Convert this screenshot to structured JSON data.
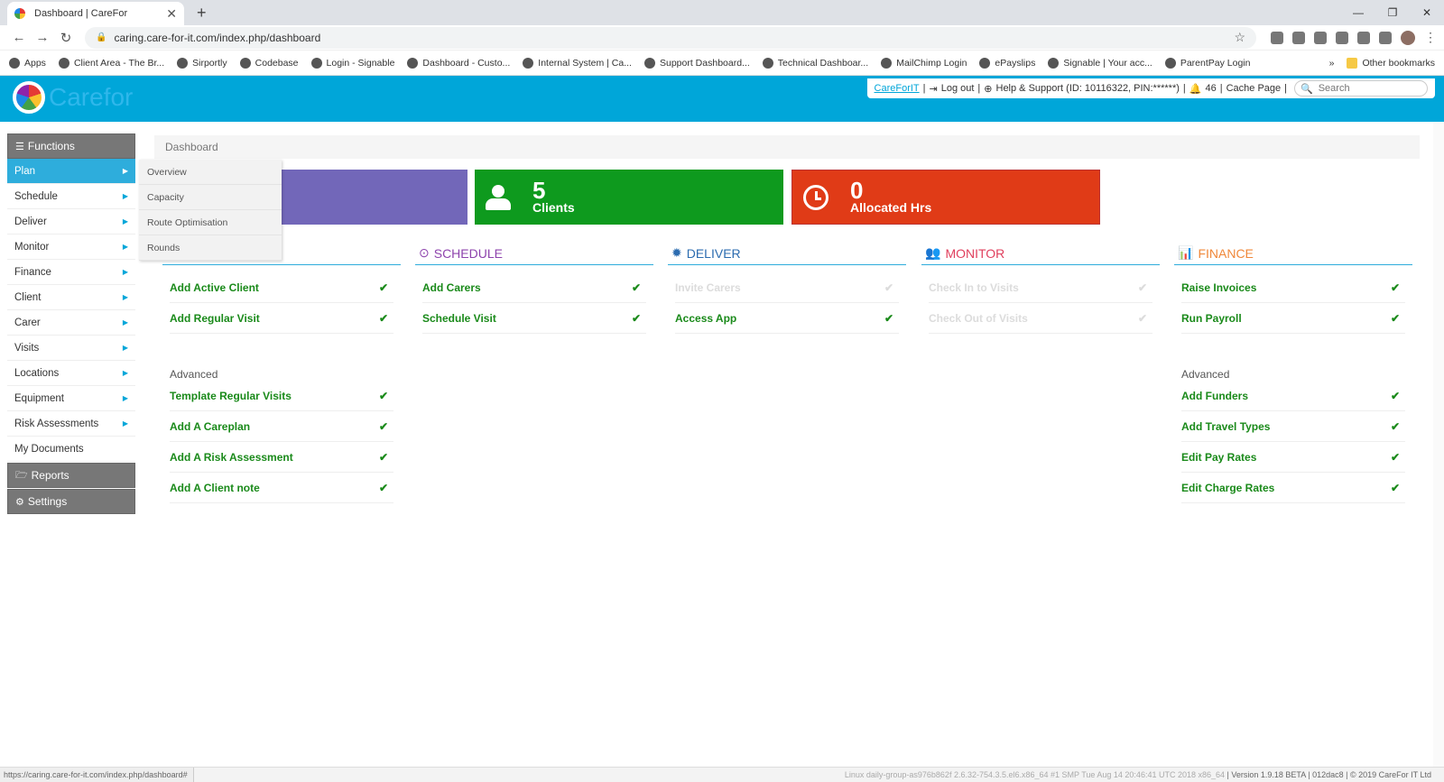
{
  "browser": {
    "tab_title": "Dashboard | CareFor",
    "new_tab": "+",
    "url": "caring.care-for-it.com/index.php/dashboard",
    "bookmarks": [
      "Apps",
      "Client Area - The Br...",
      "Sirportly",
      "Codebase",
      "Login - Signable",
      "Dashboard - Custo...",
      "Internal System | Ca...",
      "Support Dashboard...",
      "Technical Dashboar...",
      "MailChimp Login",
      "ePayslips",
      "Signable | Your acc...",
      "ParentPay Login"
    ],
    "bookmarks_more": "»",
    "other_bookmarks": "Other bookmarks"
  },
  "header": {
    "logo_text": "Carefor",
    "user_link": "CareForIT",
    "logout": "Log out",
    "help": "Help & Support (ID: 10116322, PIN:******)",
    "notifications": "46",
    "cache_page": "Cache Page",
    "search_placeholder": "Search"
  },
  "sidebar": {
    "functions_label": "Functions",
    "items": [
      {
        "label": "Plan",
        "arrow": "▶"
      },
      {
        "label": "Schedule",
        "arrow": "▶"
      },
      {
        "label": "Deliver",
        "arrow": "▶"
      },
      {
        "label": "Monitor",
        "arrow": "▶"
      },
      {
        "label": "Finance",
        "arrow": "▶"
      },
      {
        "label": "Client",
        "arrow": "▶"
      },
      {
        "label": "Carer",
        "arrow": "▶"
      },
      {
        "label": "Visits",
        "arrow": "▶"
      },
      {
        "label": "Locations",
        "arrow": "▶"
      },
      {
        "label": "Equipment",
        "arrow": "▶"
      },
      {
        "label": "Risk Assessments",
        "arrow": "▶"
      },
      {
        "label": "My Documents",
        "arrow": ""
      }
    ],
    "reports_label": "Reports",
    "settings_label": "Settings"
  },
  "submenu": [
    "Overview",
    "Capacity",
    "Route Optimisation",
    "Rounds"
  ],
  "breadcrumb": "Dashboard",
  "tiles": {
    "clients_num": "5",
    "clients_label": "Clients",
    "hours_num": "0",
    "hours_label": "Allocated Hrs"
  },
  "columns": {
    "schedule": {
      "title": "SCHEDULE",
      "color": "#8e44ad",
      "items": [
        "Add Carers",
        "Schedule Visit"
      ]
    },
    "deliver": {
      "title": "DELIVER",
      "color": "#2c6cb0",
      "items": [
        "Invite Carers",
        "Access App"
      ]
    },
    "monitor": {
      "title": "MONITOR",
      "color": "#e0405e",
      "items": [
        "Check In to Visits",
        "Check Out of Visits"
      ]
    },
    "finance": {
      "title": "FINANCE",
      "color": "#f0883a",
      "items": [
        "Raise Invoices",
        "Run Payroll"
      ],
      "advanced_label": "Advanced",
      "advanced": [
        "Add Funders",
        "Add Travel Types",
        "Edit Pay Rates",
        "Edit Charge Rates"
      ]
    },
    "plan": {
      "items": [
        "Add Active Client",
        "Add Regular Visit"
      ],
      "advanced_label": "Advanced",
      "advanced": [
        "Template Regular Visits",
        "Add A Careplan",
        "Add A Risk Assessment",
        "Add A Client note"
      ]
    }
  },
  "tick": "✔",
  "status": {
    "hover_url": "https://caring.care-for-it.com/index.php/dashboard#",
    "system": "Linux daily-group-as976b862f 2.6.32-754.3.5.el6.x86_64 #1 SMP Tue Aug 14 20:46:41 UTC 2018 x86_64",
    "version": "Version 1.9.18 BETA",
    "build": "012dac8",
    "copyright": "© 2019 CareFor IT Ltd"
  }
}
